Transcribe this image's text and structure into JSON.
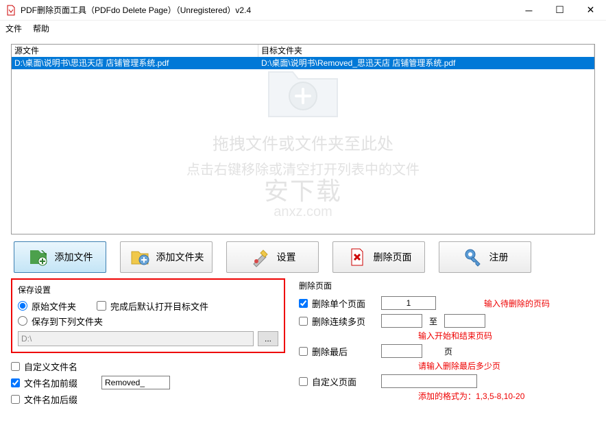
{
  "titlebar": {
    "text": "PDF删除页面工具（PDFdo Delete Page）（Unregistered）v2.4"
  },
  "menu": {
    "file": "文件",
    "help": "帮助"
  },
  "fileList": {
    "header": {
      "source": "源文件",
      "target": "目标文件夹"
    },
    "rows": [
      {
        "source": "D:\\桌面\\说明书\\思迅天店 店铺管理系统.pdf",
        "target": "D:\\桌面\\说明书\\Removed_思迅天店 店铺管理系统.pdf"
      }
    ],
    "dropHint1": "拖拽文件或文件夹至此处",
    "dropHint2": "点击右键移除或清空打开列表中的文件"
  },
  "brand": {
    "big": "安下载",
    "small": "anxz.com"
  },
  "toolbar": {
    "addFile": "添加文件",
    "addFolder": "添加文件夹",
    "settings": "设置",
    "deletePage": "删除页面",
    "register": "注册"
  },
  "saveSettings": {
    "title": "保存设置",
    "originalFolder": "原始文件夹",
    "openAfterDone": "完成后默认打开目标文件",
    "saveToFolder": "保存到下列文件夹",
    "path": "D:\\",
    "browse": "...",
    "customName": "自定义文件名",
    "prefix": "文件名加前缀",
    "prefixValue": "Removed_",
    "suffix": "文件名加后缀"
  },
  "deleteSettings": {
    "title": "删除页面",
    "single": "删除单个页面",
    "singleValue": "1",
    "singleHint": "输入待删除的页码",
    "multi": "删除连续多页",
    "to": "至",
    "multiHint": "输入开始和结束页码",
    "last": "删除最后",
    "lastUnit": "页",
    "lastHint": "请输入删除最后多少页",
    "custom": "自定义页面",
    "customHint": "添加的格式为：1,3,5-8,10-20"
  }
}
